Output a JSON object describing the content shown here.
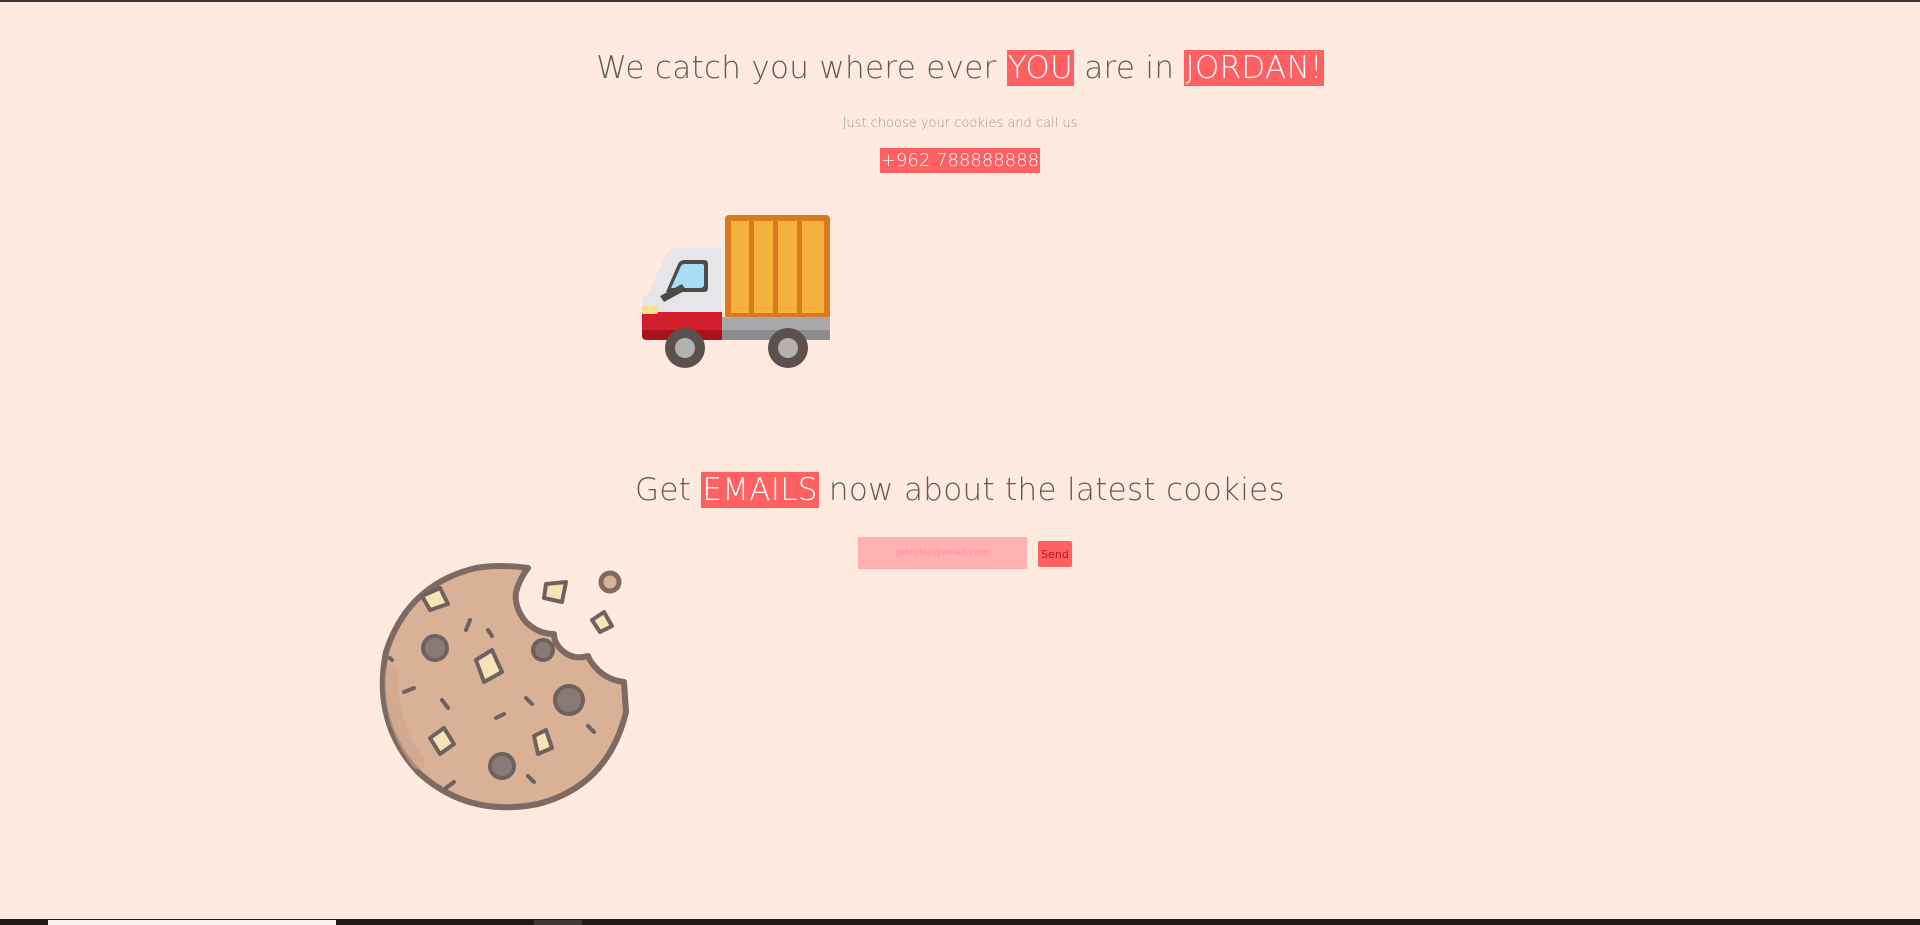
{
  "hero": {
    "headline_part1": "We catch you where ever ",
    "headline_highlight1": "YOU",
    "headline_part2": " are in ",
    "headline_highlight2": "JORDAN!",
    "subtitle": "Just choose your cookies and call us",
    "phone": "+962 788888888"
  },
  "newsletter": {
    "headline_part1": "Get ",
    "headline_highlight": "EMAILS",
    "headline_part2": " now about the latest cookies",
    "email_placeholder": "johndoe@email.com",
    "send_label": "Send"
  },
  "illustrations": {
    "truck": "delivery-truck-icon",
    "cookie": "bitten-cookie-icon"
  },
  "colors": {
    "background": "#ffeae0",
    "accent": "#ff6163",
    "input_bg": "#ffb0b0",
    "text": "#5b5b5b"
  }
}
